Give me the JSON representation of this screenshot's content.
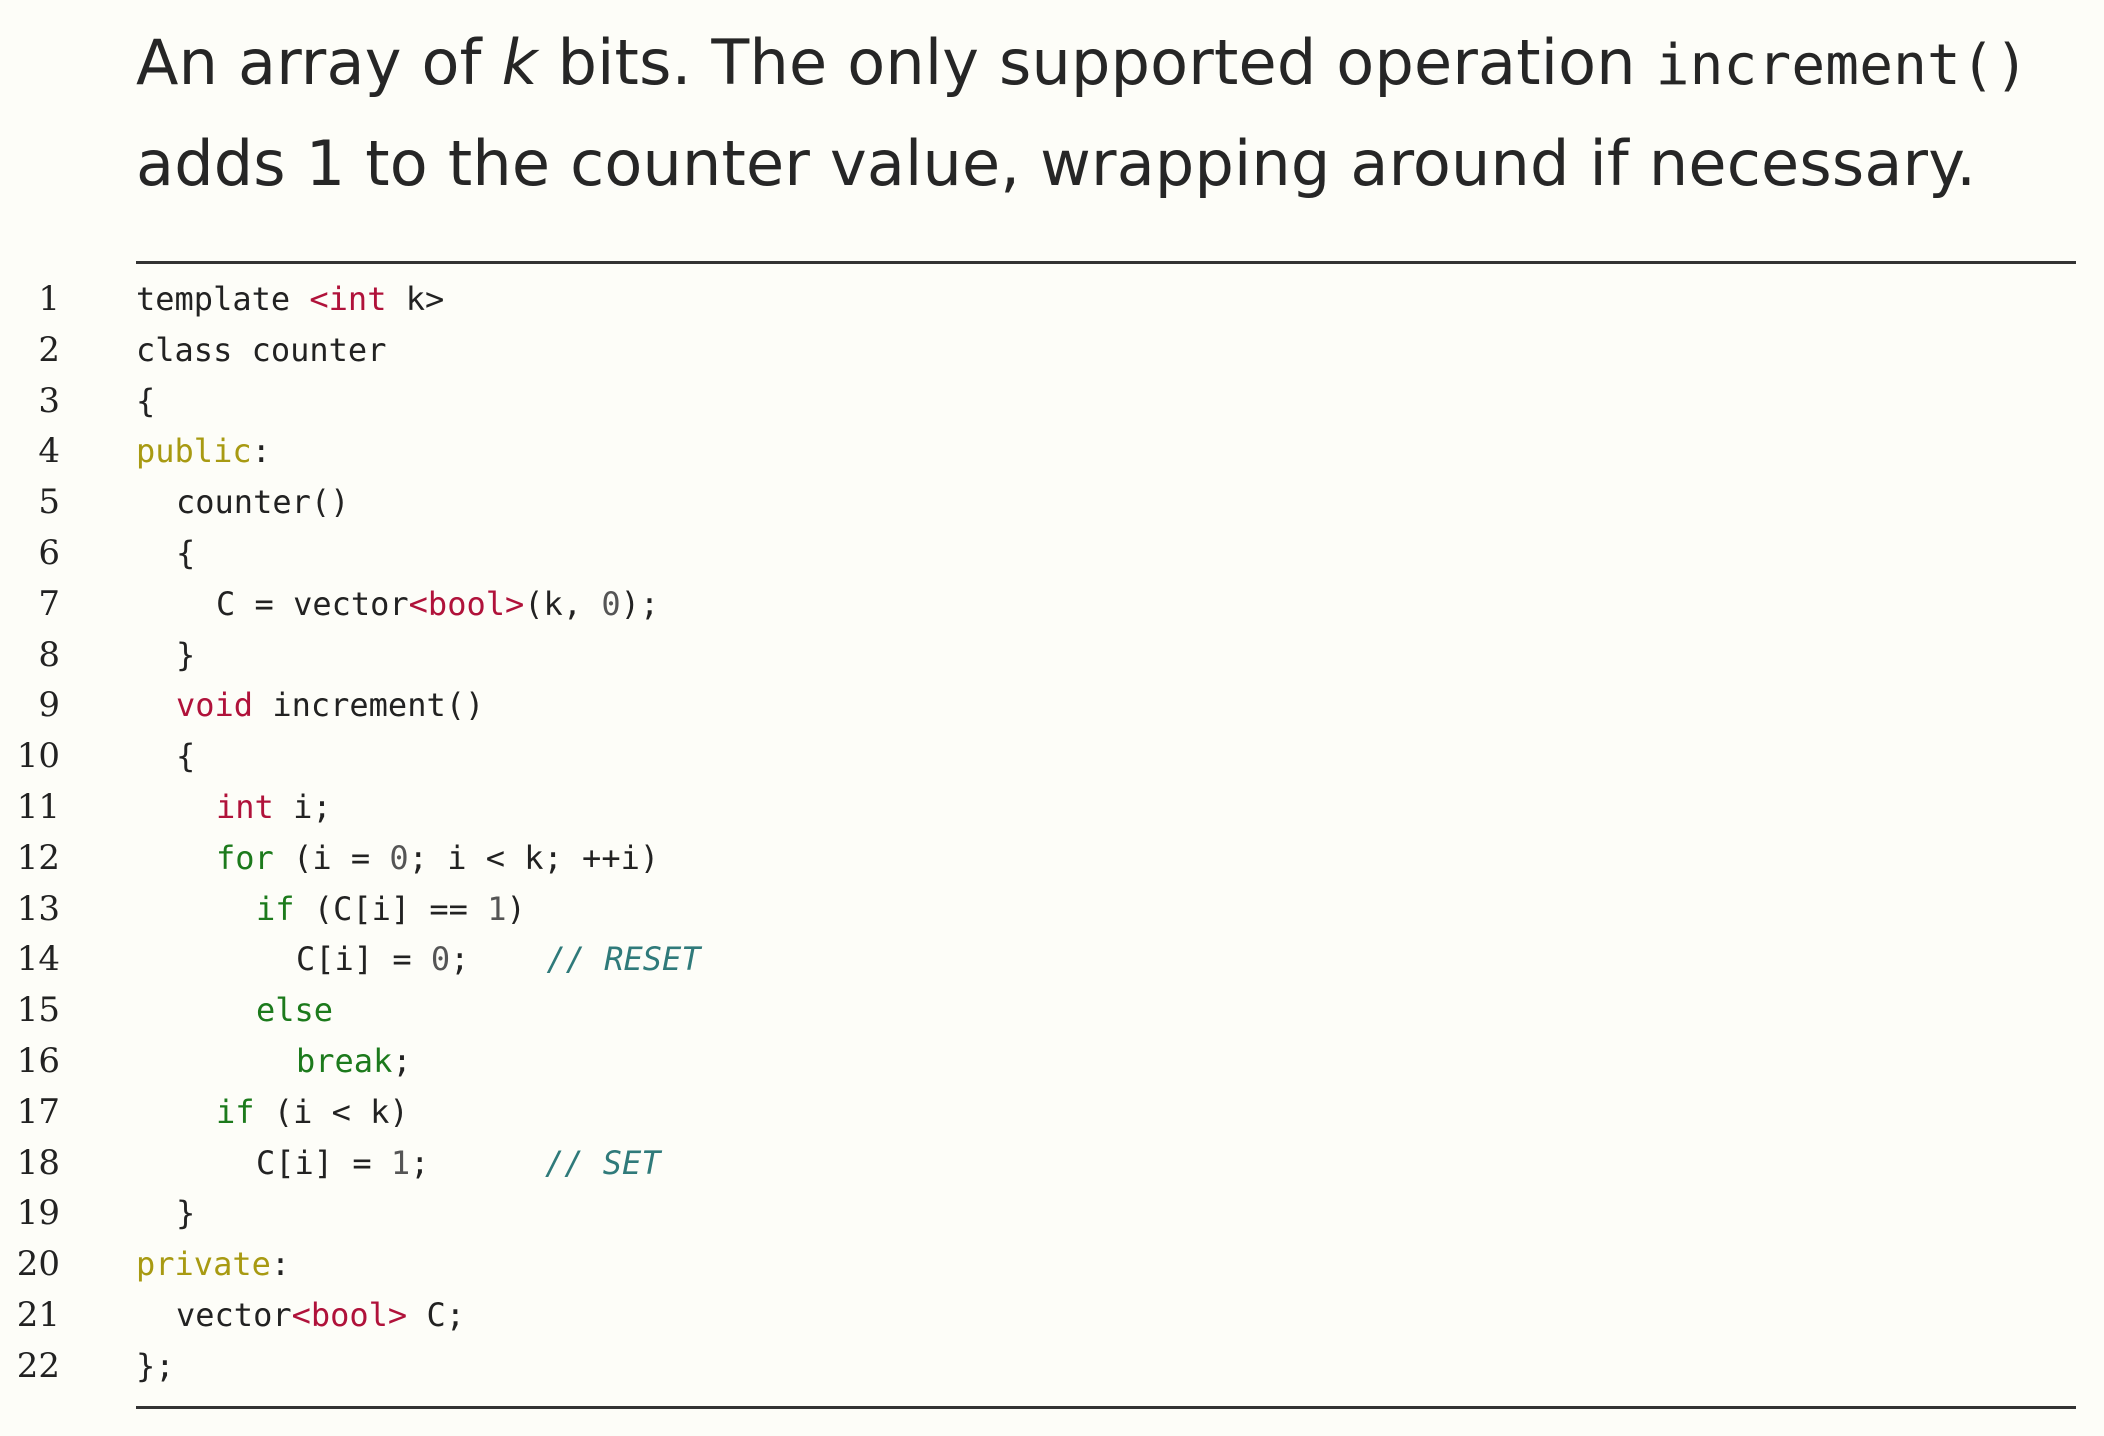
{
  "intro": {
    "p1": "An array of ",
    "var_k": "k",
    "p2": " bits.  The only supported operation ",
    "fn": "increment()",
    "p3": "adds 1 to the counter value, wrapping around if necessary."
  },
  "colors": {
    "type_keyword": "#b0123a",
    "control_keyword": "#1c7a1c",
    "access_keyword": "#a89a12",
    "comment": "#2f7a7a"
  },
  "code": {
    "lines": [
      {
        "n": "1",
        "indent": 0,
        "tokens": [
          [
            "plain",
            "template "
          ],
          [
            "type",
            "<int"
          ],
          [
            "plain",
            " k>"
          ]
        ]
      },
      {
        "n": "2",
        "indent": 0,
        "tokens": [
          [
            "plain",
            "class counter"
          ]
        ]
      },
      {
        "n": "3",
        "indent": 0,
        "tokens": [
          [
            "plain",
            "{"
          ]
        ]
      },
      {
        "n": "4",
        "indent": 0,
        "tokens": [
          [
            "acc",
            "public"
          ],
          [
            "plain",
            ":"
          ]
        ]
      },
      {
        "n": "5",
        "indent": 1,
        "tokens": [
          [
            "plain",
            "counter()"
          ]
        ]
      },
      {
        "n": "6",
        "indent": 1,
        "tokens": [
          [
            "plain",
            "{"
          ]
        ]
      },
      {
        "n": "7",
        "indent": 2,
        "tokens": [
          [
            "plain",
            "C = vector"
          ],
          [
            "type",
            "<bool>"
          ],
          [
            "plain",
            "(k, "
          ],
          [
            "num",
            "0"
          ],
          [
            "plain",
            ");"
          ]
        ]
      },
      {
        "n": "8",
        "indent": 1,
        "tokens": [
          [
            "plain",
            "}"
          ]
        ]
      },
      {
        "n": "9",
        "indent": 1,
        "tokens": [
          [
            "type",
            "void"
          ],
          [
            "plain",
            " increment()"
          ]
        ]
      },
      {
        "n": "10",
        "indent": 1,
        "tokens": [
          [
            "plain",
            "{"
          ]
        ]
      },
      {
        "n": "11",
        "indent": 2,
        "tokens": [
          [
            "type",
            "int"
          ],
          [
            "plain",
            " i;"
          ]
        ]
      },
      {
        "n": "12",
        "indent": 2,
        "tokens": [
          [
            "ctrl",
            "for"
          ],
          [
            "plain",
            " (i = "
          ],
          [
            "num",
            "0"
          ],
          [
            "plain",
            "; i < k; ++i)"
          ]
        ]
      },
      {
        "n": "13",
        "indent": 3,
        "tokens": [
          [
            "ctrl",
            "if"
          ],
          [
            "plain",
            " (C[i] == "
          ],
          [
            "num",
            "1"
          ],
          [
            "plain",
            ")"
          ]
        ]
      },
      {
        "n": "14",
        "indent": 4,
        "tokens": [
          [
            "plain",
            "C[i] = "
          ],
          [
            "num",
            "0"
          ],
          [
            "plain",
            ";    "
          ],
          [
            "cmt",
            "// RESET"
          ]
        ]
      },
      {
        "n": "15",
        "indent": 3,
        "tokens": [
          [
            "ctrl",
            "else"
          ]
        ]
      },
      {
        "n": "16",
        "indent": 4,
        "tokens": [
          [
            "ctrl",
            "break"
          ],
          [
            "plain",
            ";"
          ]
        ]
      },
      {
        "n": "17",
        "indent": 2,
        "tokens": [
          [
            "ctrl",
            "if"
          ],
          [
            "plain",
            " (i < k)"
          ]
        ]
      },
      {
        "n": "18",
        "indent": 3,
        "tokens": [
          [
            "plain",
            "C[i] = "
          ],
          [
            "num",
            "1"
          ],
          [
            "plain",
            ";      "
          ],
          [
            "cmt",
            "// SET"
          ]
        ]
      },
      {
        "n": "19",
        "indent": 1,
        "tokens": [
          [
            "plain",
            "}"
          ]
        ]
      },
      {
        "n": "20",
        "indent": 0,
        "tokens": [
          [
            "acc",
            "private"
          ],
          [
            "plain",
            ":"
          ]
        ]
      },
      {
        "n": "21",
        "indent": 1,
        "tokens": [
          [
            "plain",
            "vector"
          ],
          [
            "type",
            "<bool>"
          ],
          [
            "plain",
            " C;"
          ]
        ]
      },
      {
        "n": "22",
        "indent": 0,
        "tokens": [
          [
            "plain",
            "};"
          ]
        ]
      }
    ]
  }
}
